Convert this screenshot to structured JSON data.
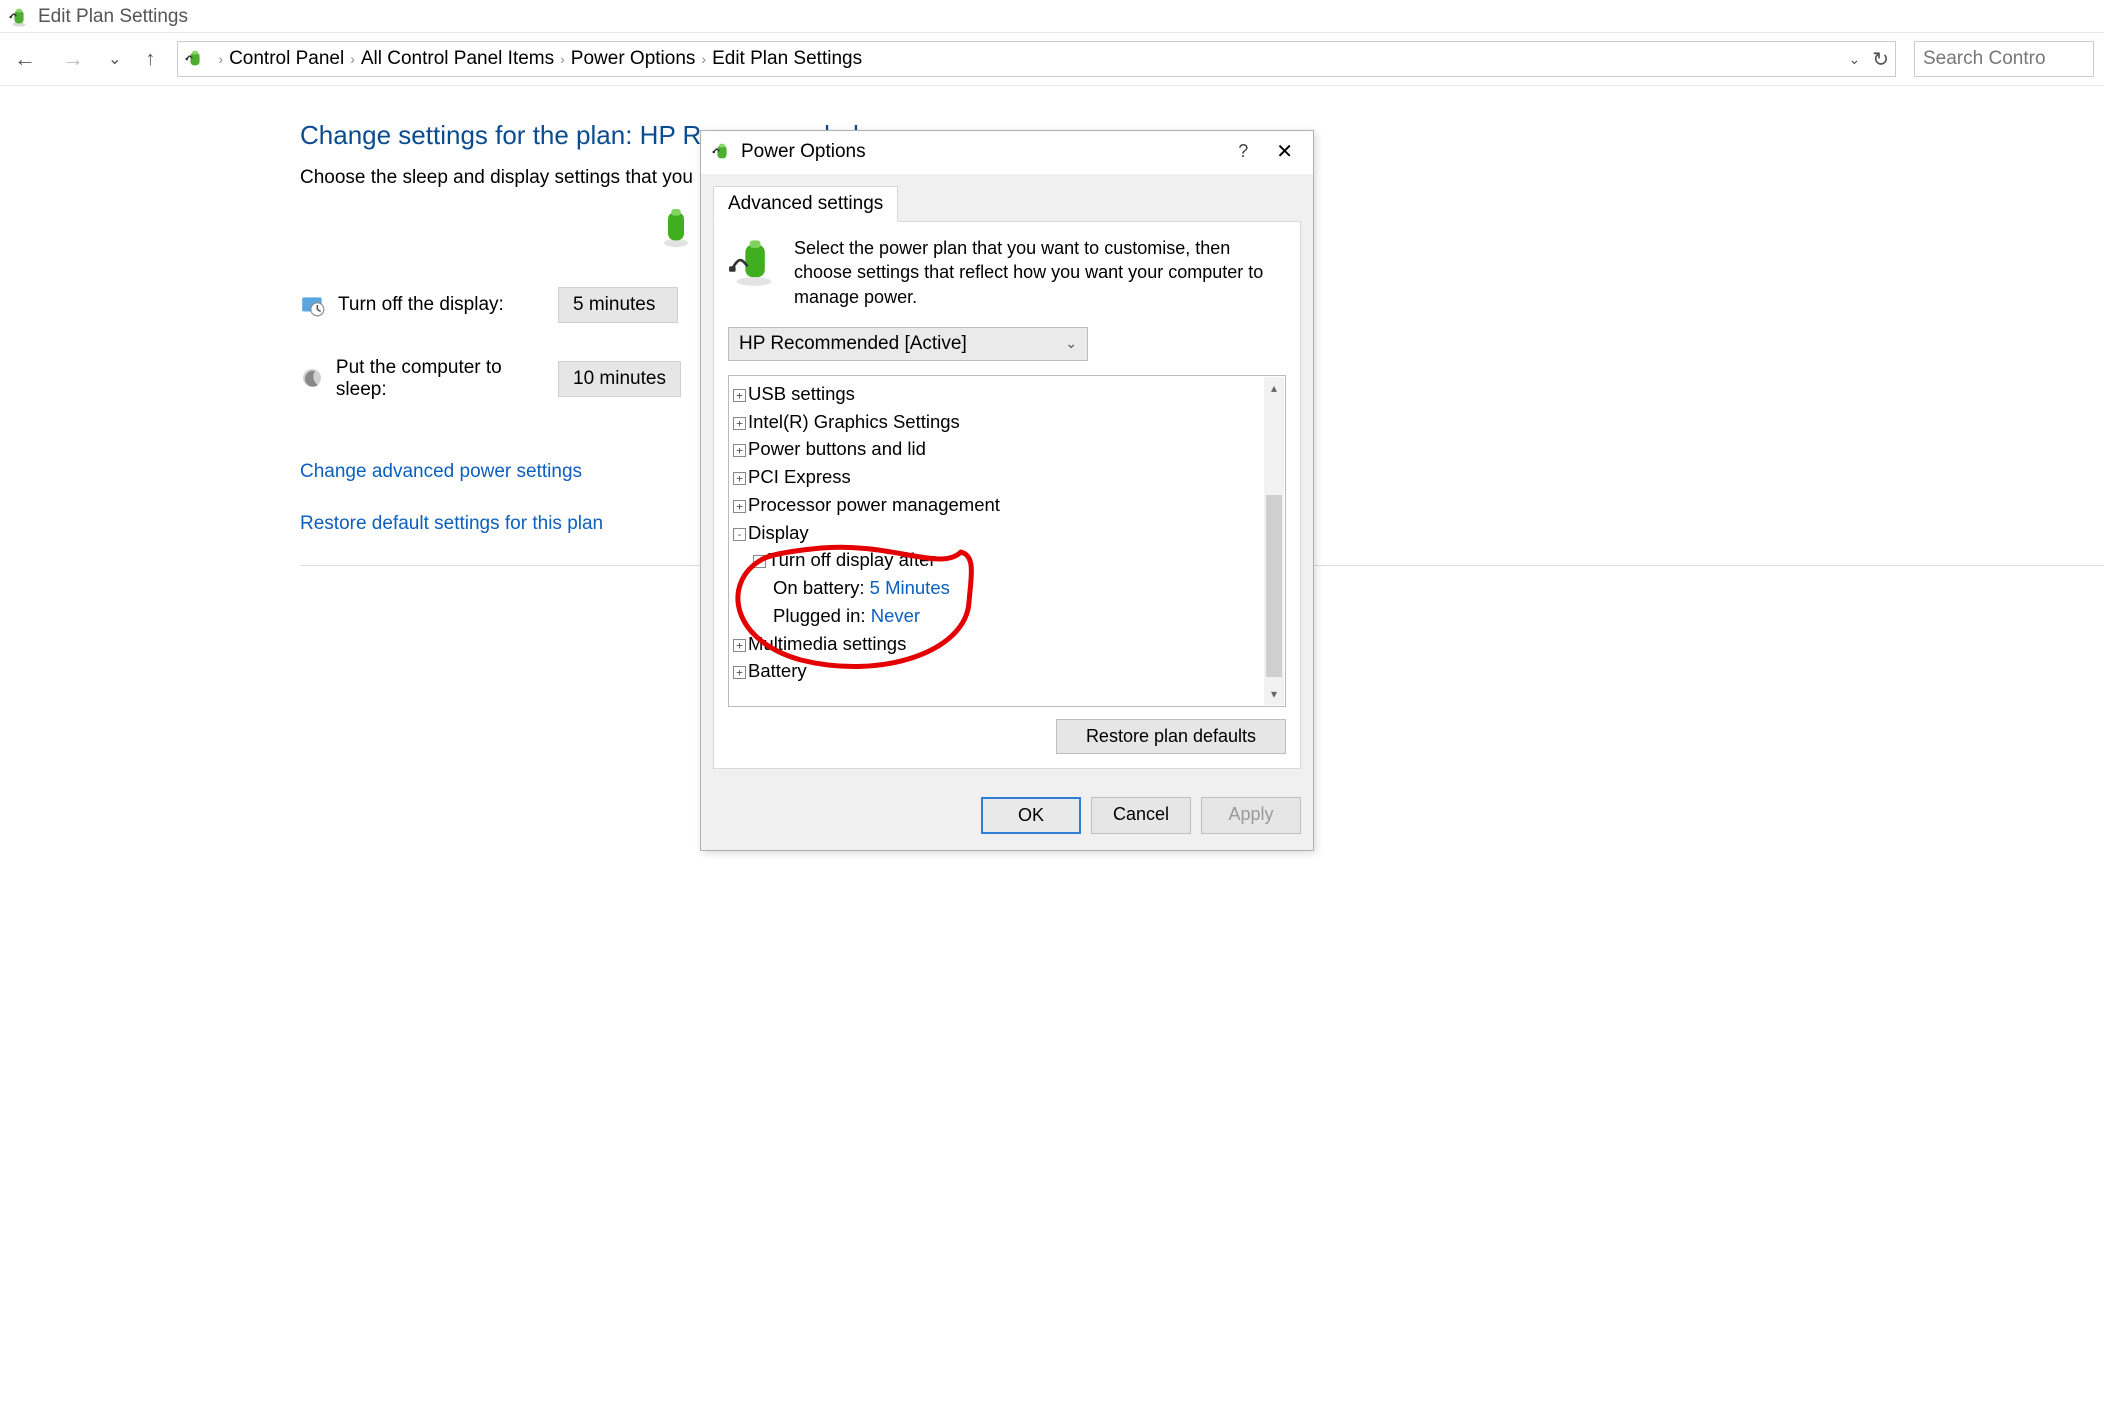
{
  "window": {
    "title": "Edit Plan Settings"
  },
  "nav": {
    "crumbs": [
      "Control Panel",
      "All Control Panel Items",
      "Power Options",
      "Edit Plan Settings"
    ],
    "search_placeholder": "Search Contro"
  },
  "page": {
    "heading_prefix": "Change settings for the plan: ",
    "heading_plan": "HP Recommended",
    "subtext": "Choose the sleep and display settings that you",
    "row_display_label": "Turn off the display:",
    "row_display_value": "5 minutes",
    "row_sleep_label": "Put the computer to sleep:",
    "row_sleep_value": "10 minutes",
    "link_advanced": "Change advanced power settings",
    "link_restore": "Restore default settings for this plan"
  },
  "dialog": {
    "title": "Power Options",
    "tab": "Advanced settings",
    "intro": "Select the power plan that you want to customise, then choose settings that reflect how you want your computer to manage power.",
    "plan_selected": "HP Recommended [Active]",
    "restore_btn": "Restore plan defaults",
    "ok": "OK",
    "cancel": "Cancel",
    "apply": "Apply",
    "tree": {
      "n0": "USB settings",
      "n1": "Intel(R) Graphics Settings",
      "n2": "Power buttons and lid",
      "n3": "PCI Express",
      "n4": "Processor power management",
      "n5": "Display",
      "n5a": "Turn off display after",
      "n5a_bat_lbl": "On battery: ",
      "n5a_bat_val": "5 Minutes",
      "n5a_plg_lbl": "Plugged in: ",
      "n5a_plg_val": "Never",
      "n6": "Multimedia settings",
      "n7": "Battery"
    }
  }
}
